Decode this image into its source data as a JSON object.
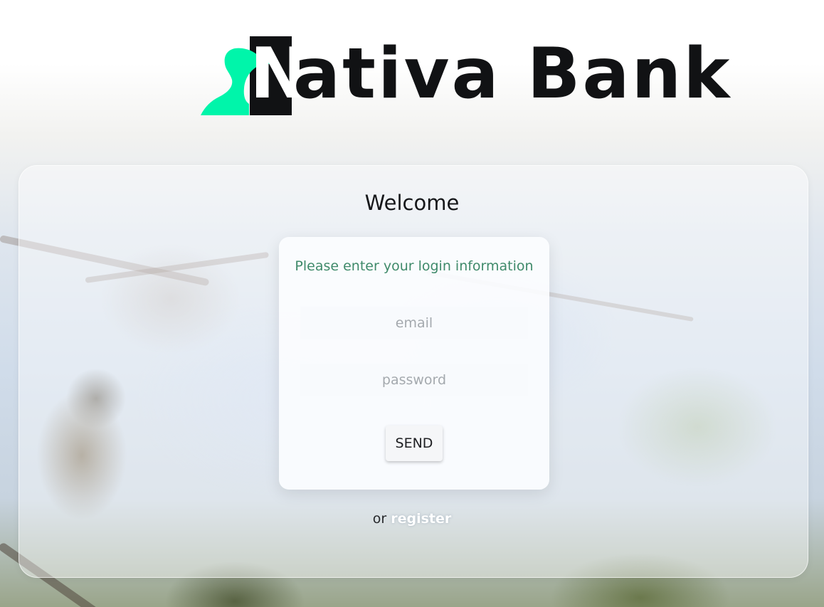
{
  "brand": {
    "logo_letter": "N",
    "logo_text": "ativa Bank",
    "colors": {
      "bird": "#00f5aa",
      "logo_dark": "#111214"
    },
    "icon": "heron-bird-icon"
  },
  "login": {
    "title": "Welcome",
    "instructions": "Please enter your login information",
    "email_placeholder": "email",
    "password_placeholder": "password",
    "send_label": "SEND"
  },
  "footer": {
    "or_text": "or",
    "register_label": "register"
  },
  "colors": {
    "instructions_text": "#3f8a6a",
    "link": "#ffffff"
  }
}
